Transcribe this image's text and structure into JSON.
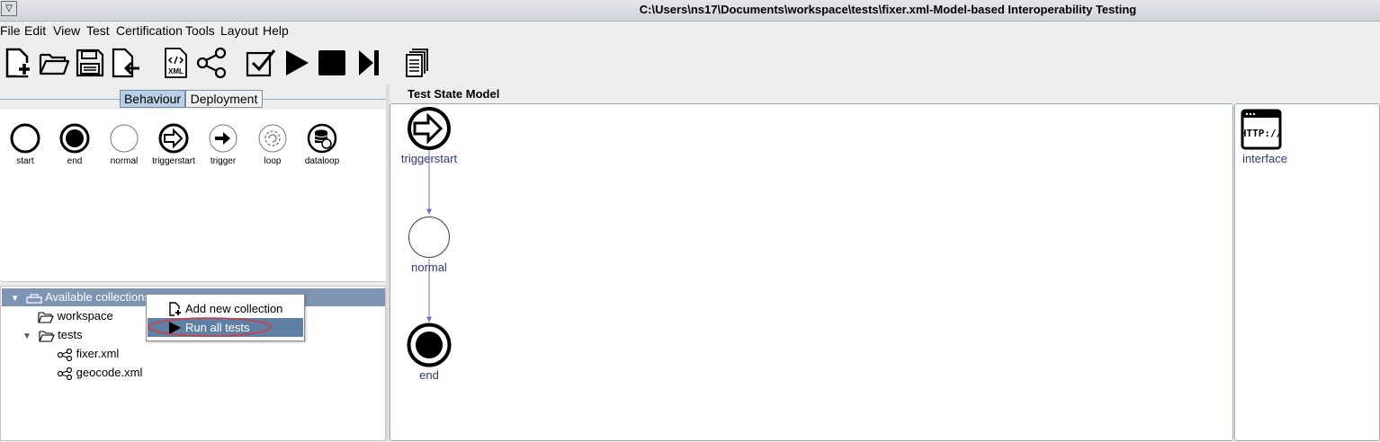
{
  "window": {
    "title": "C:\\Users\\ns17\\Documents\\workspace\\tests\\fixer.xml-Model-based Interoperability Testing",
    "system_button": "▽"
  },
  "menu": [
    "File",
    "Edit",
    "View",
    "Test",
    "Certification",
    "Tools",
    "Layout",
    "Help"
  ],
  "toolbar": {
    "buttons": [
      "new-file-icon",
      "open-folder-icon",
      "save-icon",
      "export-icon",
      "xml-icon",
      "share-graph-icon",
      "check-icon",
      "play-icon",
      "stop-icon",
      "step-icon",
      "documents-icon"
    ],
    "xml_label": "XML"
  },
  "left_tabs": {
    "tabs": [
      "Behaviour",
      "Deployment"
    ],
    "active": "Behaviour"
  },
  "palette": {
    "items": [
      "start",
      "end",
      "normal",
      "triggerstart",
      "trigger",
      "loop",
      "dataloop"
    ]
  },
  "tree": {
    "root": "Available collections",
    "items": [
      "workspace",
      "tests",
      "fixer.xml",
      "geocode.xml"
    ]
  },
  "context_menu": {
    "items": [
      "Add new collection",
      "Run all tests"
    ],
    "highlighted": "Run all tests",
    "highlight_color": "#5f7fa3",
    "annotation_color": "#d9363e"
  },
  "model": {
    "header": "Test State Model",
    "nodes": {
      "triggerstart": "triggerstart",
      "normal": "normal",
      "end": "end"
    },
    "edge_color": "#6a6fd1"
  },
  "right_panel": {
    "interface_label": "interface",
    "http_text": "HTTP://"
  }
}
